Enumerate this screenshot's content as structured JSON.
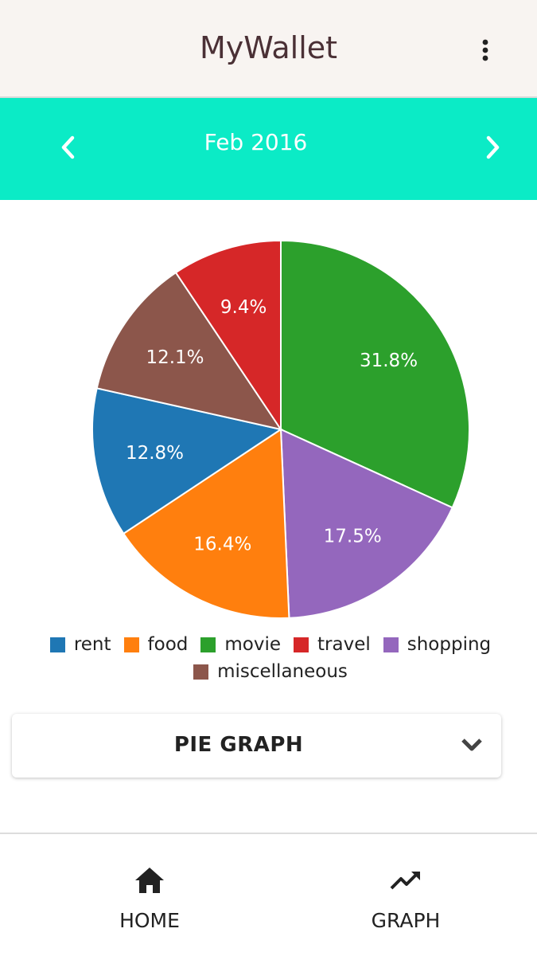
{
  "app": {
    "title": "MyWallet"
  },
  "month_nav": {
    "label": "Feb 2016"
  },
  "chart_data": {
    "type": "pie",
    "categories": [
      "movie",
      "shopping",
      "food",
      "rent",
      "miscellaneous",
      "travel"
    ],
    "values": [
      31.8,
      17.5,
      16.4,
      12.8,
      12.1,
      9.4
    ],
    "value_labels": [
      "31.8%",
      "17.5%",
      "16.4%",
      "12.8%",
      "12.1%",
      "9.4%"
    ],
    "colors": [
      "#2ca02c",
      "#9467bd",
      "#ff7f0e",
      "#1f77b4",
      "#8c564b",
      "#d62728"
    ],
    "start": "12 o'clock, clockwise",
    "legend": [
      {
        "label": "rent",
        "color": "#1f77b4"
      },
      {
        "label": "food",
        "color": "#ff7f0e"
      },
      {
        "label": "movie",
        "color": "#2ca02c"
      },
      {
        "label": "travel",
        "color": "#d62728"
      },
      {
        "label": "shopping",
        "color": "#9467bd"
      },
      {
        "label": "miscellaneous",
        "color": "#8c564b"
      }
    ],
    "legend_placement": "bottom"
  },
  "graph_selector": {
    "selected": "PIE GRAPH"
  },
  "bottom_nav": {
    "items": [
      {
        "label": "HOME",
        "icon": "home-icon"
      },
      {
        "label": "GRAPH",
        "icon": "trending-up-icon"
      }
    ]
  }
}
